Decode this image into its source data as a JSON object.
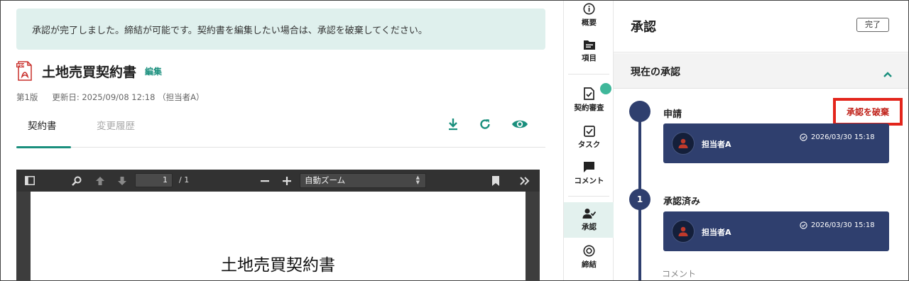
{
  "notice": {
    "text": "承認が完了しました。締結が可能です。契約書を編集したい場合は、承認を破棄してください。"
  },
  "document": {
    "title": "土地売買契約書",
    "edit_label": "編集",
    "version": "第1版",
    "updated": "更新日: 2025/09/08 12:18 （担当者A）"
  },
  "tabs": [
    {
      "label": "契約書",
      "active": true
    },
    {
      "label": "変更履歴",
      "active": false
    }
  ],
  "tab_actions": [
    "download-icon",
    "refresh-icon",
    "preview-eye-icon"
  ],
  "pdf_viewer": {
    "page_current": "1",
    "page_total": "/ 1",
    "zoom": "自動ズーム",
    "page_heading": "土地売買契約書"
  },
  "rail": {
    "items": [
      {
        "label": "概要",
        "icon": "info-icon"
      },
      {
        "label": "項目",
        "icon": "folder-icon"
      },
      {
        "label": "契約審査",
        "icon": "document-check-icon"
      },
      {
        "label": "タスク",
        "icon": "task-checkbox-icon"
      },
      {
        "label": "コメント",
        "icon": "comment-icon"
      },
      {
        "label": "承認",
        "icon": "user-check-icon",
        "active": true
      },
      {
        "label": "締結",
        "icon": "target-circle-icon"
      }
    ]
  },
  "panel": {
    "title": "承認",
    "done_label": "完了",
    "section_title": "現在の承認",
    "discard_label": "承認を破棄",
    "steps": [
      {
        "node": "",
        "label": "申請",
        "person": "担当者A",
        "date": "2026/03/30 15:18"
      },
      {
        "node": "1",
        "label": "承認済み",
        "person": "担当者A",
        "date": "2026/03/30 15:18"
      }
    ],
    "comment_label": "コメント"
  },
  "colors": {
    "accent_teal": "#1a8f7d",
    "navy": "#2f3f6e",
    "notice_bg": "#dff0ed",
    "discard_red": "#e3251b",
    "rail_active_bg": "#e3f1ee",
    "status_dot": "#3fb79a"
  }
}
